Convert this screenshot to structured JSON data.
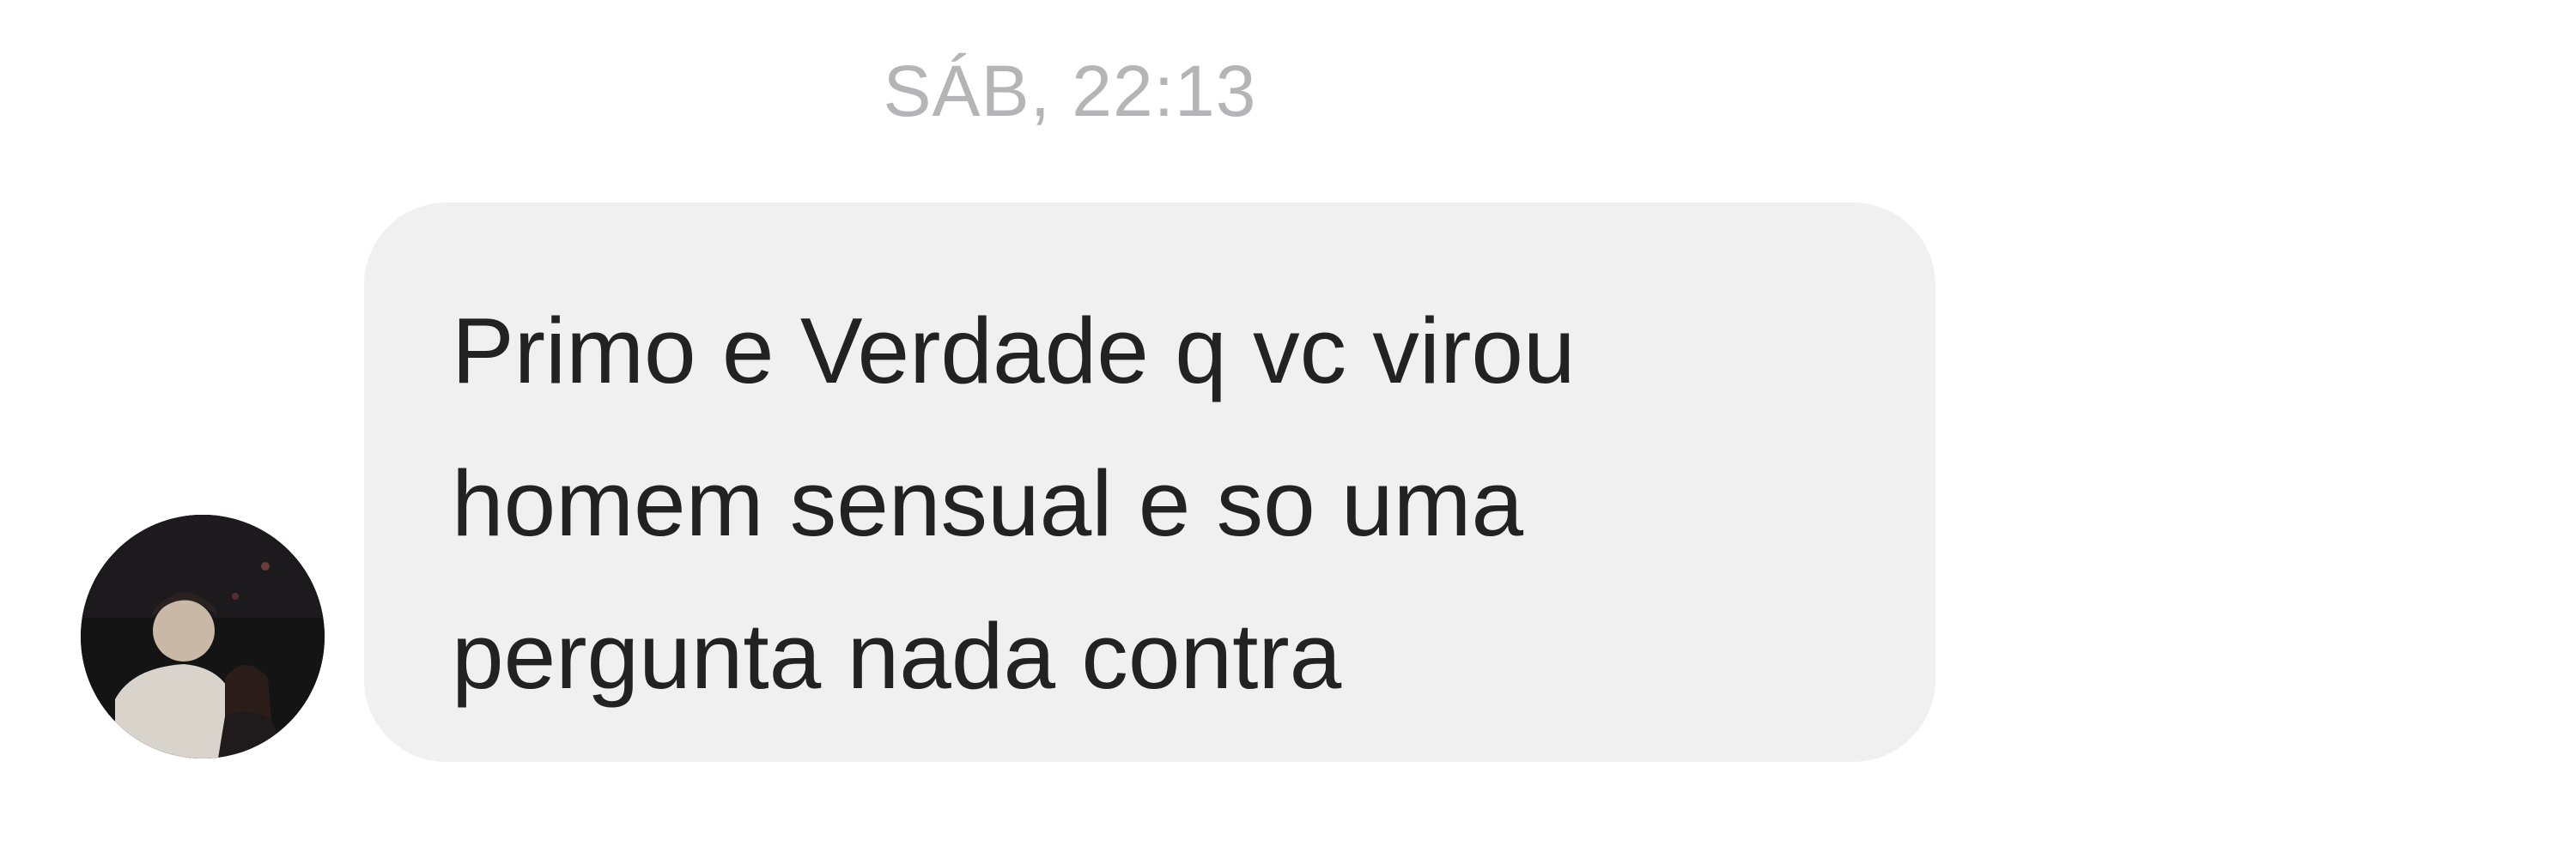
{
  "conversation": {
    "timestamp": "SÁB, 22:13",
    "messages": [
      {
        "direction": "incoming",
        "text": "Primo e Verdade q vc virou\nhomem sensual e so uma\npergunta nada contra",
        "avatar_icon": "user-photo-avatar"
      }
    ]
  },
  "colors": {
    "background": "#ffffff",
    "bubble": "#f0f0f0",
    "message_text": "#222222",
    "timestamp_text": "#b5b5b8"
  }
}
